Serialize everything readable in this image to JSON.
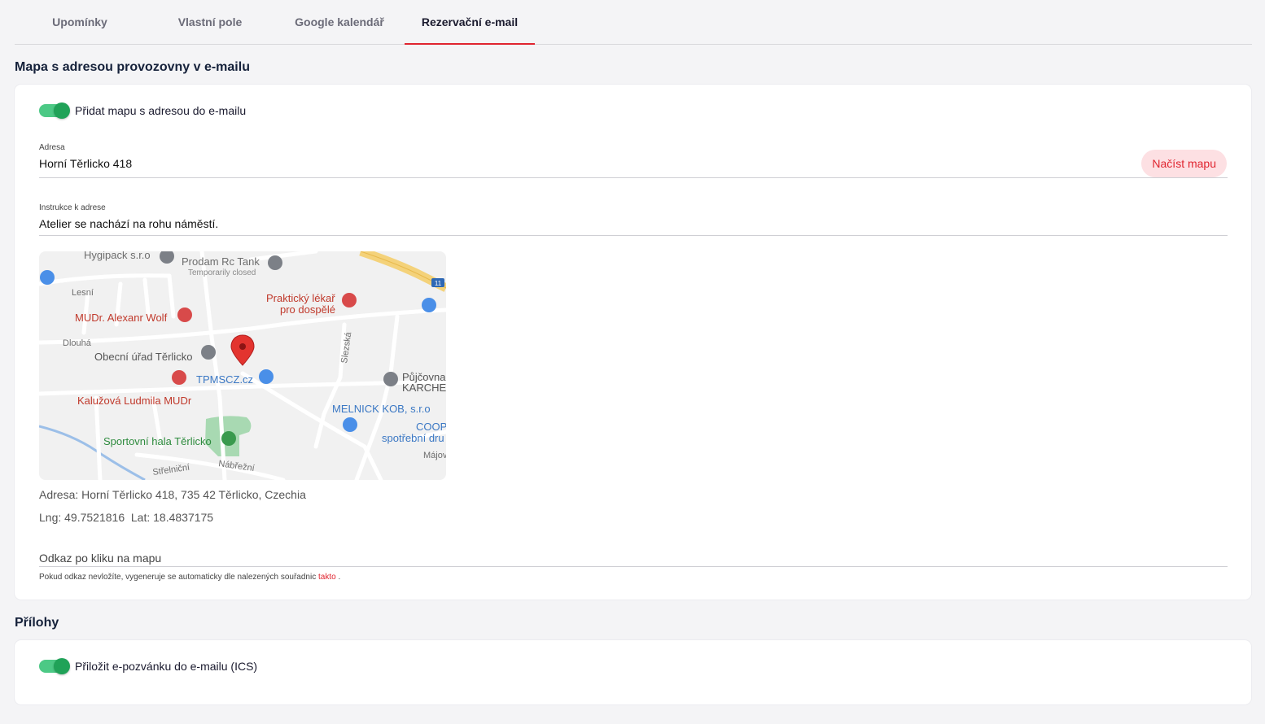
{
  "tabs": [
    {
      "label": "Upomínky"
    },
    {
      "label": "Vlastní pole"
    },
    {
      "label": "Google kalendář"
    },
    {
      "label": "Rezervační e-mail"
    }
  ],
  "map_section": {
    "title": "Mapa s adresou provozovny v e-mailu",
    "toggle_label": "Přidat mapu s adresou do e-mailu",
    "address_label": "Adresa",
    "address_value": "Horní Těrlicko 418",
    "load_map_button": "Načíst mapu",
    "instructions_label": "Instrukce k adrese",
    "instructions_value": "Atelier se nachází na rohu náměstí.",
    "resolved_address": "Adresa: Horní Těrlicko 418, 735 42 Těrlicko, Czechia",
    "coords": "Lng: 49.7521816  Lat: 18.4837175",
    "link_placeholder": "Odkaz po kliku na mapu",
    "hint_text": "Pokud odkaz nevložíte, vygeneruje se automaticky dle nalezených souřadnic",
    "hint_link": "takto",
    "hint_end": "."
  },
  "map": {
    "labels": {
      "hygipack": "Hygipack s.r.o",
      "prodam": "Prodam Rc Tank",
      "temp_closed": "Temporarily closed",
      "lesni": "Lesní",
      "prakticky1": "Praktický lékař",
      "prakticky2": "pro dospělé",
      "wolf": "MUDr. Alexanr Wolf",
      "dlouha": "Dlouhá",
      "obecni": "Obecní úřad Těrlicko",
      "slezska": "Slezská",
      "tpmscz": "TPMSCZ.cz",
      "pujcovna1": "Půjčovna",
      "pujcovna2": "KARCHE",
      "kaluzova": "Kalužová Ludmila MUDr",
      "melnick": "MELNICK KOB, s.r.o",
      "coop1": "COOP",
      "coop2": "spotřební dru",
      "sportovni": "Sportovní hala Těrlicko",
      "strelnicni": "Střelniční",
      "nabrezni": "Nábřežní",
      "majova": "Májov",
      "road_no": "11"
    },
    "colors": {
      "medical": "#d84a4a",
      "shop": "#4a8fe8",
      "park": "#3a9a4e",
      "gray_poi": "#7c8087",
      "pin": "#e3342f"
    }
  },
  "attachments_section": {
    "title": "Přílohy",
    "toggle_label": "Přiložit e-pozvánku do e-mailu (ICS)"
  }
}
